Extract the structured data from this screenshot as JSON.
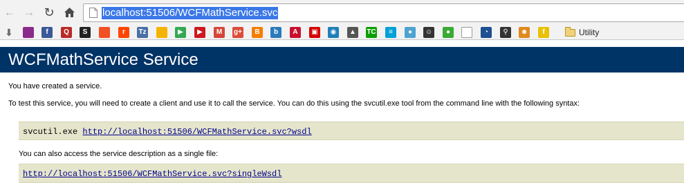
{
  "browser": {
    "back_icon": "arrow-left-icon",
    "forward_icon": "arrow-right-icon",
    "reload_icon": "reload-icon",
    "home_icon": "home-icon",
    "url": "localhost:51506/WCFMathService.svc"
  },
  "bookmarks": {
    "items": [
      {
        "icon": "bookmark-download-icon",
        "glyph": "⬇",
        "color": "#6b6b6b"
      },
      {
        "icon": "windows-logo-icon",
        "glyph": "",
        "color": "#8a2a8a"
      },
      {
        "icon": "facebook-icon",
        "glyph": "f",
        "color": "#3b5998"
      },
      {
        "icon": "quora-icon",
        "glyph": "Q",
        "color": "#b92b27"
      },
      {
        "icon": "stack-icon",
        "glyph": "S",
        "color": "#222222"
      },
      {
        "icon": "microsoft-tiles-icon",
        "glyph": "",
        "color": "#f25022"
      },
      {
        "icon": "reddit-icon",
        "glyph": "r",
        "color": "#ff4500"
      },
      {
        "icon": "tz-icon",
        "glyph": "Tz",
        "color": "#4a6fa5"
      },
      {
        "icon": "note-icon",
        "glyph": "",
        "color": "#f4b400"
      },
      {
        "icon": "play-store-icon",
        "glyph": "▶",
        "color": "#34a853"
      },
      {
        "icon": "youtube-icon",
        "glyph": "▶",
        "color": "#cc181e"
      },
      {
        "icon": "gmail-icon",
        "glyph": "M",
        "color": "#d44638"
      },
      {
        "icon": "google-plus-icon",
        "glyph": "g+",
        "color": "#dd4b39"
      },
      {
        "icon": "blogger-icon",
        "glyph": "B",
        "color": "#f57d00"
      },
      {
        "icon": "b-circle-icon",
        "glyph": "b",
        "color": "#2b7bb9"
      },
      {
        "icon": "a-icon",
        "glyph": "A",
        "color": "#c8102e"
      },
      {
        "icon": "hub-icon",
        "glyph": "▣",
        "color": "#d50000"
      },
      {
        "icon": "feed-icon",
        "glyph": "◉",
        "color": "#1e7fb8"
      },
      {
        "icon": "photo-icon",
        "glyph": "▲",
        "color": "#555555"
      },
      {
        "icon": "techcrunch-icon",
        "glyph": "TC",
        "color": "#0a9e01"
      },
      {
        "icon": "stripes-icon",
        "glyph": "≡",
        "color": "#00a1d6"
      },
      {
        "icon": "drop-icon",
        "glyph": "●",
        "color": "#4fa3d1"
      },
      {
        "icon": "face-icon",
        "glyph": "☺",
        "color": "#333333"
      },
      {
        "icon": "chat-bubble-icon",
        "glyph": "●",
        "color": "#3aaa35"
      },
      {
        "icon": "blank-page-icon",
        "glyph": "",
        "color": "#dddddd"
      },
      {
        "icon": "pie-icon",
        "glyph": "◔",
        "color": "#1d4f91"
      },
      {
        "icon": "bike-icon",
        "glyph": "⚲",
        "color": "#333333"
      },
      {
        "icon": "avatar-icon",
        "glyph": "☻",
        "color": "#e08a1e"
      },
      {
        "icon": "f-script-icon",
        "glyph": "f",
        "color": "#e8c200"
      }
    ],
    "folder_icon": "folder-icon",
    "folder_label": "Utility"
  },
  "page": {
    "heading": "WCFMathService Service",
    "intro": "You have created a service.",
    "instructions": "To test this service, you will need to create a client and use it to call the service. You can do this using the svcutil.exe tool from the command line with the following syntax:",
    "command": "svcutil.exe",
    "wsdl_link": "http://localhost:51506/WCFMathService.svc?wsdl",
    "single_file_text": "You can also access the service description as a single file:",
    "single_wsdl_link": "http://localhost:51506/WCFMathService.svc?singleWsdl"
  },
  "colors": {
    "heading_bar": "#003366",
    "code_background": "#e5e5cc",
    "link": "#00008b",
    "url_highlight": "#3b78e7"
  }
}
